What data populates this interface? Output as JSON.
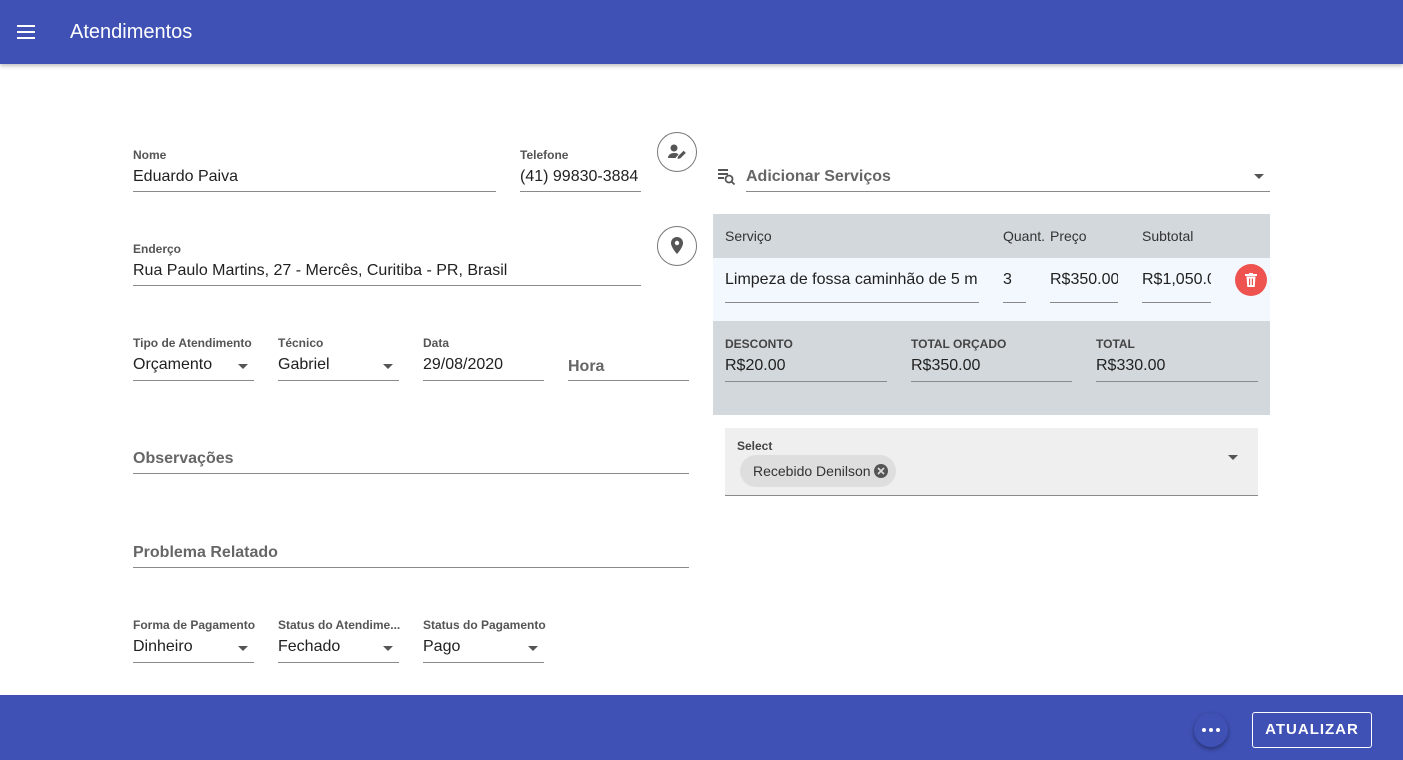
{
  "app": {
    "title": "Atendimentos"
  },
  "form": {
    "nome": {
      "label": "Nome",
      "value": "Eduardo Paiva"
    },
    "telefone": {
      "label": "Telefone",
      "value": "(41) 99830-3884"
    },
    "endereco": {
      "label": "Enderço",
      "value": "Rua Paulo Martins, 27 - Mercês, Curitiba - PR, Brasil"
    },
    "tipo_atendimento": {
      "label": "Tipo de Atendimento",
      "value": "Orçamento"
    },
    "tecnico": {
      "label": "Técnico",
      "value": "Gabriel"
    },
    "data": {
      "label": "Data",
      "value": "29/08/2020"
    },
    "hora": {
      "placeholder": "Hora"
    },
    "observacoes": {
      "placeholder": "Observações"
    },
    "problema": {
      "placeholder": "Problema Relatado"
    },
    "forma_pagamento": {
      "label": "Forma de Pagamento",
      "value": "Dinheiro"
    },
    "status_atendimento": {
      "label": "Status do Atendime...",
      "value": "Fechado"
    },
    "status_pagamento": {
      "label": "Status do Pagamento",
      "value": "Pago"
    }
  },
  "services": {
    "add_placeholder": "Adicionar Serviços",
    "columns": {
      "servico": "Serviço",
      "quant": "Quant.",
      "preco": "Preço",
      "subtotal": "Subtotal"
    },
    "rows": [
      {
        "servico": "Limpeza de fossa caminhão de 5 m",
        "quant": "3",
        "preco": "R$350.00",
        "subtotal": "R$1,050.00"
      }
    ]
  },
  "summary": {
    "desconto": {
      "label": "DESCONTO",
      "value": "R$20.00"
    },
    "total_orcado": {
      "label": "TOTAL ORÇADO",
      "value": "R$350.00"
    },
    "total": {
      "label": "TOTAL",
      "value": "R$330.00"
    }
  },
  "select": {
    "label": "Select",
    "chips": [
      "Recebido Denilson"
    ]
  },
  "footer": {
    "update_label": "ATUALIZAR"
  },
  "colors": {
    "primary": "#3f51b5",
    "danger": "#ef5350",
    "table_bg": "#d3d8dc",
    "row_bg": "#f2f8fd"
  },
  "icons": [
    "menu-icon",
    "contact-edit-icon",
    "location-pin-icon",
    "search-list-icon",
    "trash-icon",
    "chip-close-icon",
    "more-horizontal-icon"
  ]
}
